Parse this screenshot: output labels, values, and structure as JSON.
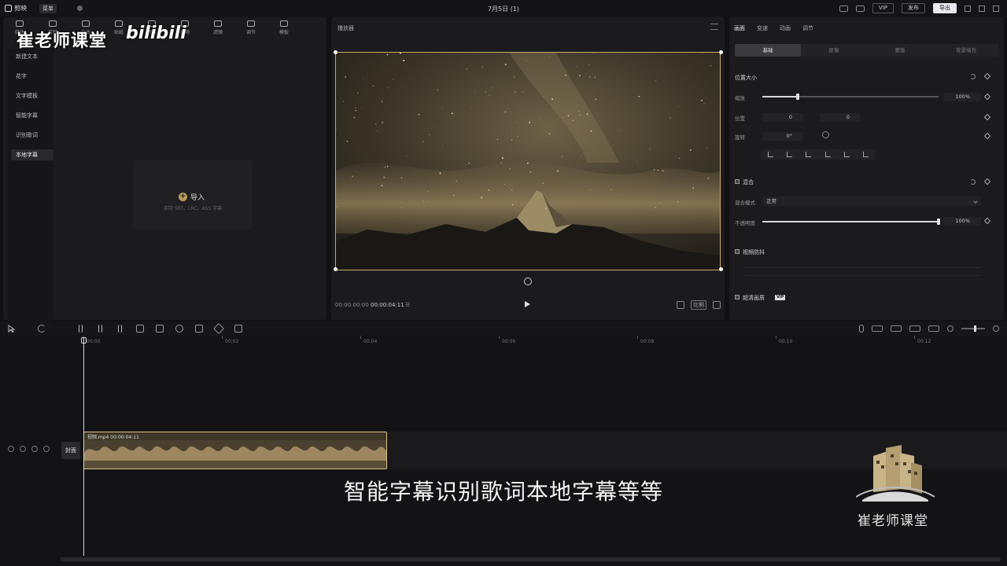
{
  "titlebar": {
    "app_name": "剪映",
    "menu_label": "菜单",
    "project_title": "7月5日 (1)",
    "vip_label": "VIP",
    "publish_label": "发布",
    "export_label": "导出"
  },
  "left_panel": {
    "top_tabs": [
      {
        "label": "媒体",
        "icon": "media-icon"
      },
      {
        "label": "音频",
        "icon": "audio-icon"
      },
      {
        "label": "文本",
        "icon": "text-icon"
      },
      {
        "label": "贴纸",
        "icon": "sticker-icon"
      },
      {
        "label": "特效",
        "icon": "effects-icon"
      },
      {
        "label": "转场",
        "icon": "transition-icon"
      },
      {
        "label": "滤镜",
        "icon": "filter-icon"
      },
      {
        "label": "调节",
        "icon": "adjust-icon"
      },
      {
        "label": "模板",
        "icon": "template-icon"
      }
    ],
    "nav_items": [
      "新建文本",
      "花字",
      "文字模板",
      "智能字幕",
      "识别歌词",
      "本地字幕"
    ],
    "active_nav": "本地字幕",
    "import": {
      "label": "导入",
      "hint": "支持 SRT、LRC、ASS 字幕"
    }
  },
  "player": {
    "title": "播放器",
    "current_time": "00:00:00:00",
    "total_time": "00:00:04:11",
    "ratio_label": "比例"
  },
  "right_panel": {
    "tabs": [
      "画面",
      "变速",
      "动画",
      "调节"
    ],
    "active_tab": "画面",
    "sub_tabs": [
      "基础",
      "抠像",
      "蒙版",
      "背景填充"
    ],
    "active_sub_tab": "基础",
    "position_size": {
      "title": "位置大小",
      "scale_label": "缩放",
      "scale_value": "100%",
      "scale_fraction": 0.2,
      "position_label": "位置",
      "x_label": "X",
      "x_value": "0",
      "y_label": "Y",
      "y_value": "0",
      "rotate_label": "旋转",
      "rotate_value": "0°"
    },
    "blend": {
      "title": "混合",
      "mode_label": "混合模式",
      "mode_value": "正常",
      "opacity_label": "不透明度",
      "opacity_value": "100%",
      "opacity_fraction": 1.0
    },
    "stabilize_label": "视频防抖",
    "superres_label": "超清画质",
    "superres_badge": "VIP"
  },
  "timeline": {
    "ruler": [
      "00:00",
      "00:02",
      "00:04",
      "00:06",
      "00:08",
      "00:10",
      "00:12"
    ],
    "cover_label": "封面",
    "clip_label": "视频.mp4   00:00:04:11"
  },
  "overlays": {
    "watermark_text": "崔老师课堂",
    "watermark_brand": "bilibili",
    "subtitle": "智能字幕识别歌词本地字幕等等",
    "logo_text": "崔老师课堂"
  },
  "colors": {
    "accent": "#caa96b",
    "background": "#111113",
    "panel": "#1b1b1e"
  }
}
